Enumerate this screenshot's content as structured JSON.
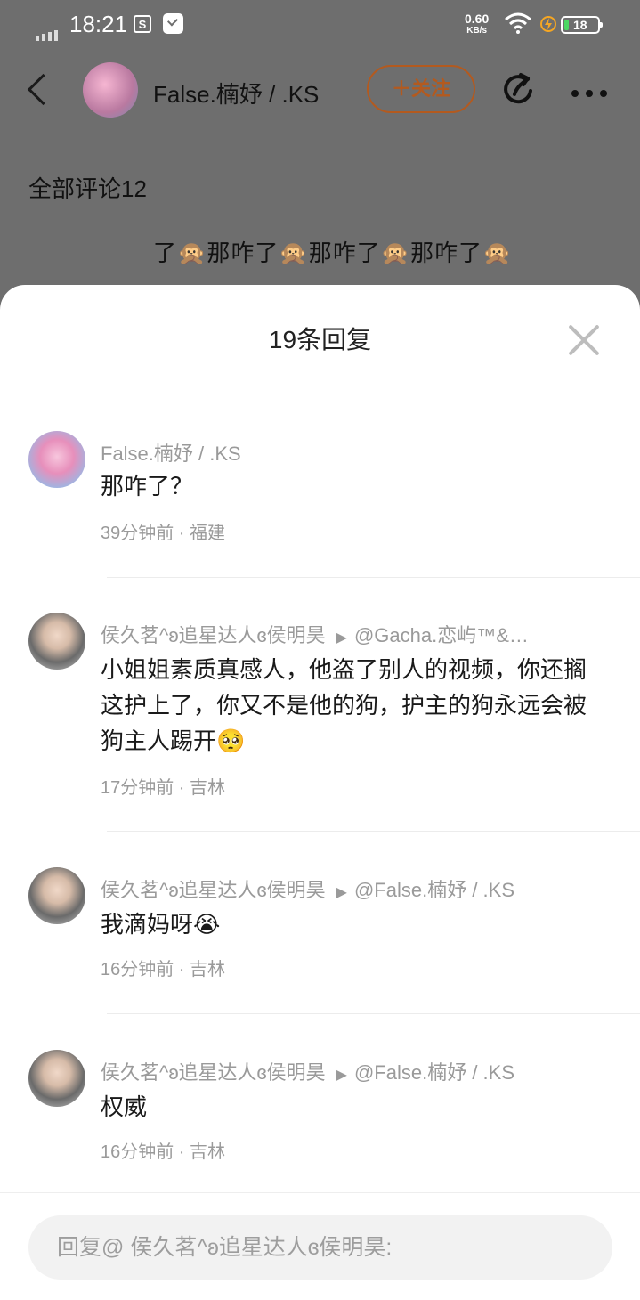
{
  "status_bar": {
    "time": "18:21",
    "net_speed": "0.60",
    "net_unit": "KB/s",
    "battery": "18"
  },
  "nav": {
    "title": "False.楠妤 / .KS",
    "follow_label": "关注",
    "follow_color": "#b35a1f"
  },
  "background": {
    "comments_title": "全部评论12",
    "snippet": "了🙊那咋了🙊那咋了🙊那咋了🙊"
  },
  "sheet": {
    "title": "19条回复"
  },
  "replies": [
    {
      "user": "False.楠妤 / .KS",
      "reply_to": "",
      "content": "那咋了？",
      "time": "39分钟前",
      "location": "福建",
      "avatar": "girl-avatar"
    },
    {
      "user": "侯久茗^ʚ追星达人ɞ侯明昊",
      "reply_to": "@Gacha.恋屿™&…",
      "content": "小姐姐素质真感人，他盗了别人的视频，你还搁这护上了，你又不是他的狗，护主的狗永远会被狗主人踢开",
      "emoji": "🥺",
      "time": "17分钟前",
      "location": "吉林",
      "avatar": "man-avatar"
    },
    {
      "user": "侯久茗^ʚ追星达人ɞ侯明昊",
      "reply_to": "@False.楠妤 / .KS",
      "content": "我滴妈呀",
      "emoji": "😭",
      "time": "16分钟前",
      "location": "吉林",
      "avatar": "man-avatar"
    },
    {
      "user": "侯久茗^ʚ追星达人ɞ侯明昊",
      "reply_to": "@False.楠妤 / .KS",
      "content": "权威",
      "time": "16分钟前",
      "location": "吉林",
      "avatar": "man-avatar"
    }
  ],
  "input": {
    "placeholder": "回复@ 侯久茗^ʚ追星达人ɞ侯明昊:"
  }
}
